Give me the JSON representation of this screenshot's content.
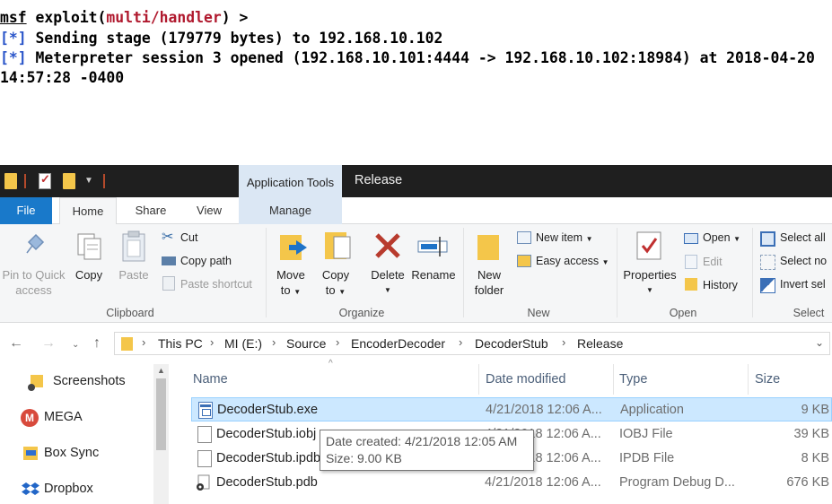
{
  "terminal": {
    "prompt_msf": "msf",
    "prompt_pre": " exploit(",
    "prompt_module": "multi/handler",
    "prompt_post": ") >",
    "tag": "[*]",
    "line2": " Sending stage (179779 bytes) to 192.168.10.102",
    "line3": " Meterpreter session 3 opened (192.168.10.101:4444 -> 192.168.10.102:18984) at 2018-04-20",
    "line4": "14:57:28 -0400"
  },
  "window": {
    "title": "Release",
    "contextual_tab": "Application Tools"
  },
  "tabs": {
    "file": "File",
    "home": "Home",
    "share": "Share",
    "view": "View",
    "manage": "Manage"
  },
  "ribbon": {
    "clipboard": {
      "group": "Clipboard",
      "pin_line1": "Pin to Quick",
      "pin_line2": "access",
      "copy": "Copy",
      "paste": "Paste",
      "cut": "Cut",
      "copy_path": "Copy path",
      "paste_shortcut": "Paste shortcut"
    },
    "organize": {
      "group": "Organize",
      "move_line1": "Move",
      "move_line2": "to",
      "copy_line1": "Copy",
      "copy_line2": "to",
      "delete": "Delete",
      "rename": "Rename"
    },
    "new": {
      "group": "New",
      "folder_line1": "New",
      "folder_line2": "folder",
      "new_item": "New item",
      "easy_access": "Easy access"
    },
    "open": {
      "group": "Open",
      "properties": "Properties",
      "open": "Open",
      "edit": "Edit",
      "history": "History"
    },
    "select": {
      "group": "Select",
      "select_all": "Select all",
      "select_none": "Select no",
      "invert": "Invert sel"
    }
  },
  "address": {
    "crumbs": [
      "This PC",
      "MI (E:)",
      "Source",
      "EncoderDecoder",
      "DecoderStub",
      "Release"
    ]
  },
  "navpane": {
    "items": [
      "Screenshots",
      "MEGA",
      "Box Sync",
      "Dropbox"
    ]
  },
  "columns": {
    "name": "Name",
    "date": "Date modified",
    "type": "Type",
    "size": "Size"
  },
  "files": [
    {
      "name": "DecoderStub.exe",
      "date": "4/21/2018 12:06 A...",
      "type": "Application",
      "size": "9 KB"
    },
    {
      "name": "DecoderStub.iobj",
      "date": "4/21/2018 12:06 A...",
      "type": "IOBJ File",
      "size": "39 KB"
    },
    {
      "name": "DecoderStub.ipdb",
      "date": "4/21/2018 12:06 A...",
      "type": "IPDB File",
      "size": "8 KB"
    },
    {
      "name": "DecoderStub.pdb",
      "date": "4/21/2018 12:06 A...",
      "type": "Program Debug D...",
      "size": "676 KB"
    }
  ],
  "tooltip": {
    "created": "Date created: 4/21/2018 12:05 AM",
    "size": "Size: 9.00 KB"
  }
}
